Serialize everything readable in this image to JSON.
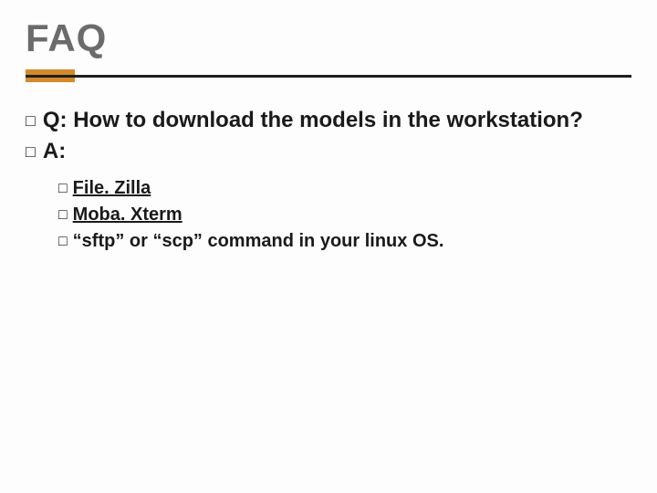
{
  "title": "FAQ",
  "items": [
    {
      "text": "Q: How to download the models in the workstation?"
    },
    {
      "text": "A:"
    }
  ],
  "sub_items": [
    {
      "text": "File. Zilla",
      "link": true
    },
    {
      "text": "Moba. Xterm",
      "link": true
    },
    {
      "text": "“sftp” or “scp” command in your linux OS.",
      "link": false
    }
  ]
}
